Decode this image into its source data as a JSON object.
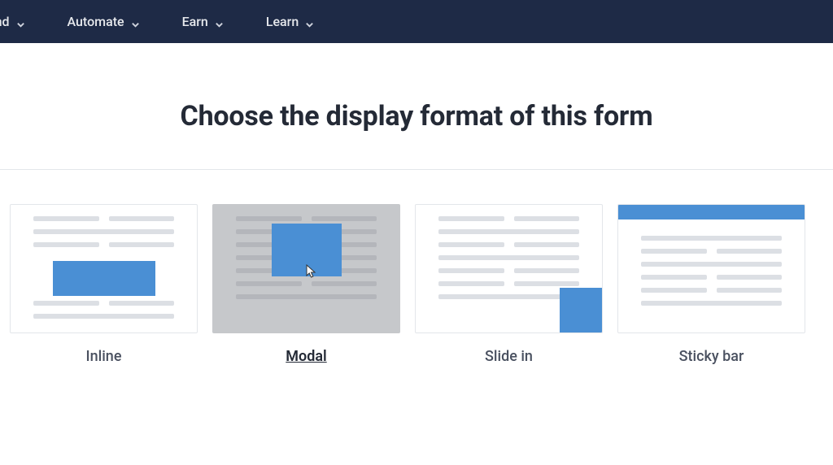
{
  "nav": {
    "items": [
      {
        "label": "end"
      },
      {
        "label": "Automate"
      },
      {
        "label": "Earn"
      },
      {
        "label": "Learn"
      }
    ]
  },
  "heading": "Choose the display format of this form",
  "options": [
    {
      "label": "Inline"
    },
    {
      "label": "Modal"
    },
    {
      "label": "Slide in"
    },
    {
      "label": "Sticky bar"
    }
  ],
  "colors": {
    "navbar": "#1e2a46",
    "accent": "#4a8fd4",
    "line_light": "#dcdfe4",
    "line_dark": "#b4b6bb",
    "card_hover_bg": "#c6c8cb"
  }
}
